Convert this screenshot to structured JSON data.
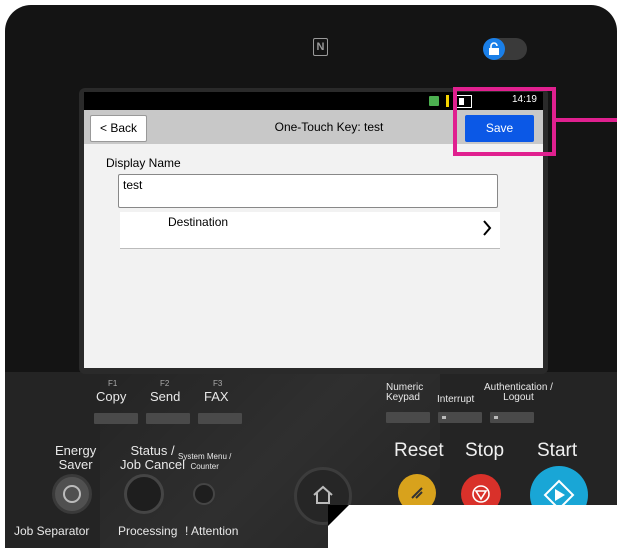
{
  "screen": {
    "status_time": "14:19",
    "back_label": "< Back",
    "title": "One-Touch Key: test",
    "save_label": "Save",
    "display_name_label": "Display Name",
    "display_name_value": "test",
    "destination_label": "Destination"
  },
  "function_keys": [
    {
      "code": "F1",
      "label": "Copy"
    },
    {
      "code": "F2",
      "label": "Send"
    },
    {
      "code": "F3",
      "label": "FAX"
    }
  ],
  "panel_keys": {
    "numeric_keypad": "Numeric\nKeypad",
    "interrupt": "Interrupt",
    "auth_logout": "Authentication /\nLogout",
    "energy_saver": "Energy\nSaver",
    "status_job_cancel": "Status /\nJob Cancel",
    "system_menu": "System Menu /\nCounter",
    "reset": "Reset",
    "stop": "Stop",
    "start": "Start",
    "job_separator": "Job Separator",
    "processing": "Processing",
    "attention": "! Attention"
  },
  "colors": {
    "highlight": "#e0208f",
    "save_button": "#0b58e6",
    "reset_button": "#d8a21c",
    "stop_button": "#d9312a",
    "start_button": "#19a6d6",
    "lock_toggle": "#1a7fe8"
  },
  "icons": {
    "nfc": "nfc-icon",
    "lock": "unlock-icon",
    "home": "home-icon",
    "chevron": "chevron-right-icon"
  }
}
